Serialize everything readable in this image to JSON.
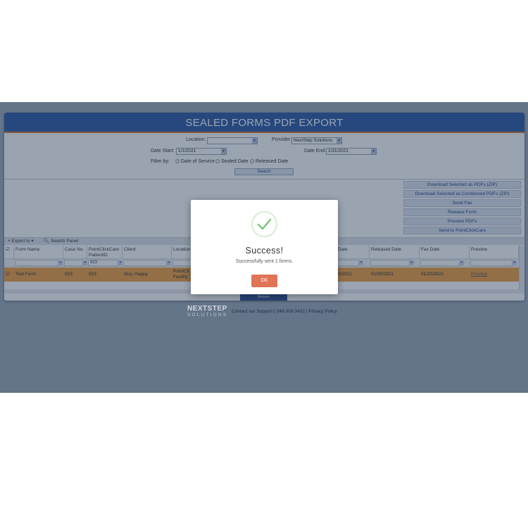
{
  "page": {
    "title": "SEALED FORMS PDF EXPORT"
  },
  "filters": {
    "location_label": "Location:",
    "location_value": "",
    "provider_label": "Provider:",
    "provider_value": "NextStep Solutions",
    "date_start_label": "Date Start:",
    "date_start_value": "1/1/2021",
    "date_end_label": "Date End:",
    "date_end_value": "1/31/2021",
    "filter_by_label": "Filter by:",
    "radio_options": [
      "Date of Service",
      "Sealed Date",
      "Released Date"
    ],
    "search_label": "Search"
  },
  "actions": [
    "Download Selected as PDFs (ZIP)",
    "Download Selected as Condensed PDFs (ZIP)",
    "Send Fax",
    "Release Form",
    "Preview PDFs",
    "Send to PointClickCare"
  ],
  "toolbar": {
    "export_label": "Export to",
    "search_panel_label": "Search Panel"
  },
  "grid": {
    "columns": [
      "Form Name",
      "Case No.",
      "PointClickCare PatientID",
      "Client",
      "Location",
      "Date",
      "Released Date",
      "Fax Date",
      "Preview"
    ],
    "filter_values": [
      "",
      "",
      "923",
      "",
      "",
      "",
      "",
      "",
      ""
    ],
    "rows": [
      {
        "form_name": "Test Form",
        "case_no": "923",
        "patient_id": "923",
        "client": "Guy, Happy",
        "location": "PointCli... Facility",
        "date": "0/2021",
        "released_date": "01/20/2021",
        "fax_date": "01/20/2021",
        "preview": "Preview"
      }
    ],
    "bottom_button": "Return"
  },
  "footer": {
    "logo_top": "NEXTSTEP",
    "logo_bottom": "SOLUTIONS",
    "links": "Contact our Support | 248-309-3402 | Privacy Policy"
  },
  "modal": {
    "title": "Success!",
    "message": "Successfully sent 1 forms.",
    "ok_label": "OK",
    "check_color": "#7cc576"
  },
  "colors": {
    "banner": "#2e5aa5",
    "selected_row": "#f0a041",
    "ok_button": "#e07457"
  }
}
